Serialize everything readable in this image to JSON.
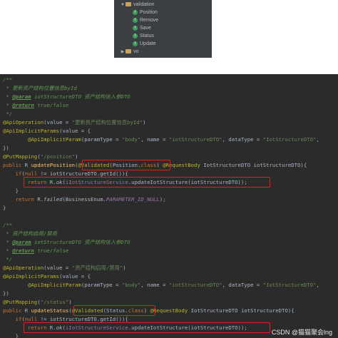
{
  "tree": {
    "folder_validation": "validation",
    "items": [
      "Position",
      "Remove",
      "Save",
      "Status",
      "Update"
    ],
    "folder_vo": "vo",
    "class_icon_letter": "I"
  },
  "code": {
    "l1": "/**",
    "l2a": " * ",
    "l2b": "更新资产结构位置信息byId",
    "l3a": " * ",
    "l3b": "@param",
    "l3c": " iotStructureDTO ",
    "l3d": "资产结构信入参DTO",
    "l4a": " * ",
    "l4b": "@return",
    "l4c": " true/false",
    "l5": " */",
    "l6a": "@ApiOperation",
    "l6b": "(value = ",
    "l6c": "\"更新资产结构位置信息byId\"",
    "l6d": ")",
    "l7a": "@ApiImplicitParams",
    "l7b": "(value = {",
    "l8a": "        @ApiImplicitParam",
    "l8b": "(paramType = ",
    "l8c": "\"body\"",
    "l8d": ", name = ",
    "l8e": "\"iotStructureDTO\"",
    "l8f": ", dataType = ",
    "l8g": "\"IotStructureDTO\"",
    "l8h": ",",
    "l9": "})",
    "l10a": "@PutMapping",
    "l10b": "(",
    "l10c": "\"/position\"",
    "l10d": ")",
    "l11a": "public ",
    "l11b": "R ",
    "l11c": "updatePosition",
    "l11d": "(",
    "l11e": "@Validated",
    "l11f": "(Position.",
    "l11g": "class",
    "l11h": ") ",
    "l11i": "@RequestBody",
    "l11j": " IotStructureDTO iotStructureDTO){",
    "l12a": "    if",
    "l12b": "(",
    "l12c": "null",
    "l12d": " != iotStructureDTO.getId()){",
    "l13a": "        return ",
    "l13b": "R.",
    "l13c": "ok",
    "l13d": "(",
    "l13e": "iIotStructureService",
    "l13f": ".updateIotStructure(iotStructureDTO));",
    "l14": "    }",
    "l15a": "    return ",
    "l15b": "R.",
    "l15c": "failed",
    "l15d": "(BusinessEnum.",
    "l15e": "PARAMETER_ID_NULL",
    "l15f": ");",
    "l16": "}",
    "m1": "/**",
    "m2a": " * ",
    "m2b": "资产结构启用/禁用",
    "m3a": " * ",
    "m3b": "@param",
    "m3c": " iotStructureDTO ",
    "m3d": "资产结构信入参DTO",
    "m4a": " * ",
    "m4b": "@return",
    "m4c": " true/false",
    "m5": " */",
    "m6a": "@ApiOperation",
    "m6b": "(value = ",
    "m6c": "\"资产结构启用/禁用\"",
    "m6d": ")",
    "m7a": "@ApiImplicitParams",
    "m7b": "(value = {",
    "m8a": "        @ApiImplicitParam",
    "m8b": "(paramType = ",
    "m8c": "\"body\"",
    "m8d": ", name = ",
    "m8e": "\"iotStructureDTO\"",
    "m8f": ", dataType = ",
    "m8g": "\"IotStructureDTO\"",
    "m8h": ",",
    "m9": "})",
    "m10a": "@PutMapping",
    "m10b": "(",
    "m10c": "\"/status\"",
    "m10d": ")",
    "m11a": "public ",
    "m11b": "R ",
    "m11c": "updateStatus",
    "m11d": "(",
    "m11e": "@Validated",
    "m11f": "(Status.",
    "m11g": "class",
    "m11h": ") ",
    "m11i": "@RequestBody",
    "m11j": " IotStructureDTO iotStructureDTO){",
    "m12a": "    if",
    "m12b": "(",
    "m12c": "null",
    "m12d": " != iotStructureDTO.getId()){",
    "m13a": "        return ",
    "m13b": "R.",
    "m13c": "ok",
    "m13d": "(",
    "m13e": "iIotStructureService",
    "m13f": ".updateIotStructure(iotStructureDTO));",
    "m14": "    }",
    "m15a": "    return ",
    "m15b": "R.",
    "m15c": "failed",
    "m15d": "(BusinessEnum.",
    "m15e": "PARAMETER_ID_NULL",
    "m15f": ");"
  },
  "watermark": "CSDN @猫猫聚会lng",
  "colors": {
    "editor_bg": "#2b2b2b",
    "tree_bg": "#3c3f41",
    "highlight_box": "#e02020",
    "comment": "#629755",
    "keyword": "#cc7832",
    "string": "#6a8759",
    "annotation": "#bbb529",
    "method": "#ffc66d"
  }
}
